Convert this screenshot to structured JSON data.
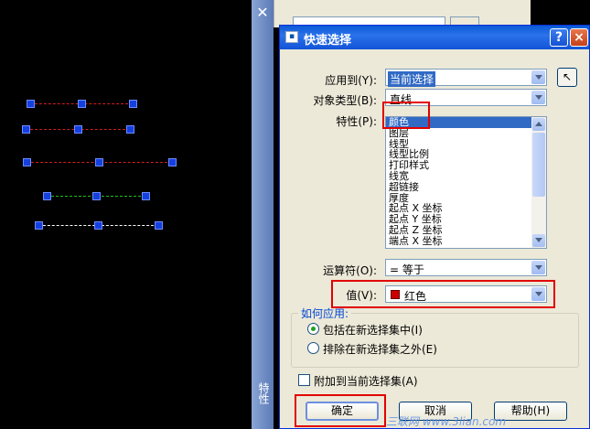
{
  "dialog": {
    "title": "快速选择",
    "help_btn": "?",
    "close_btn": "×",
    "apply_to_label": "应用到(Y):",
    "apply_to_value": "当前选择",
    "object_type_label": "对象类型(B):",
    "object_type_value": "直线",
    "property_label": "特性(P):",
    "properties": [
      "颜色",
      "图层",
      "线型",
      "线型比例",
      "打印样式",
      "线宽",
      "超链接",
      "厚度",
      "起点 X 坐标",
      "起点 Y 坐标",
      "起点 Z 坐标",
      "端点 X 坐标"
    ],
    "selected_property_index": 0,
    "operator_label": "运算符(O):",
    "operator_value": "= 等于",
    "value_label": "值(V):",
    "value_value": "红色",
    "value_color": "#cc0000",
    "how_to_apply_title": "如何应用:",
    "include_option": "包括在新选择集中(I)",
    "exclude_option": "排除在新选择集之外(E)",
    "append_label": "附加到当前选择集(A)",
    "ok_btn": "确定",
    "cancel_btn": "取消",
    "help_text_btn": "帮助(H)"
  },
  "palette": {
    "close": "✕",
    "title": "特性"
  },
  "watermark": "三联网 www.3lian.com",
  "colors": {
    "highlight": "#e20000",
    "title_blue": "#1254d8",
    "grip_blue": "#1540e0"
  }
}
